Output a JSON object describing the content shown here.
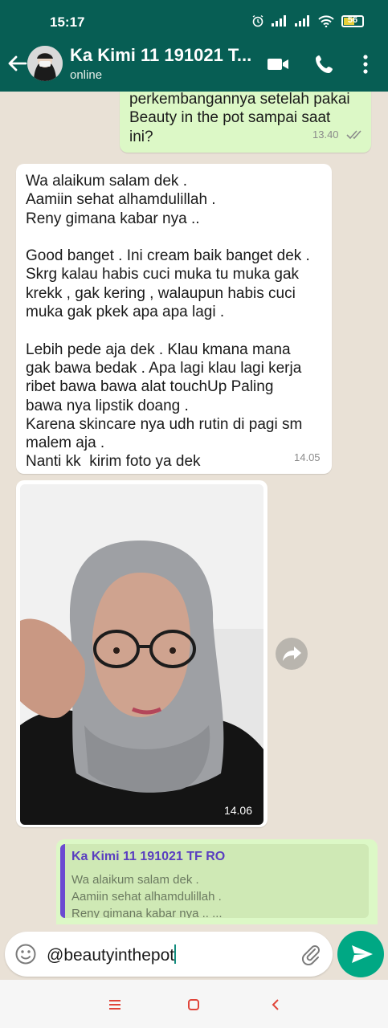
{
  "status": {
    "time": "15:17",
    "battery": "56"
  },
  "header": {
    "title": "Ka Kimi 11 191021 T...",
    "subtitle": "online"
  },
  "messages": [
    {
      "type": "out",
      "text": "perkembangannya setelah pakai\nBeauty in the pot sampai saat\nini?",
      "time": "13.40"
    },
    {
      "type": "in",
      "text": "Wa alaikum salam dek .\nAamiin sehat alhamdulillah .\nReny gimana kabar nya ..\n\nGood banget . Ini cream baik banget dek .\nSkrg kalau habis cuci muka tu muka gak\nkrekk , gak kering , walaupun habis cuci\nmuka gak pkek apa apa lagi .\n\nLebih pede aja dek . Klau kmana mana\ngak bawa bedak . Apa lagi klau lagi kerja\nribet bawa bawa alat touchUp Paling\nbawa nya lipstik doang .\nKarena skincare nya udh rutin di pagi sm\nmalem aja .\nNanti kk  kirim foto ya dek",
      "time": "14.05"
    },
    {
      "type": "in-image",
      "time": "14.06"
    }
  ],
  "reply": {
    "name": "Ka Kimi 11 191021 TF RO",
    "lines": [
      "Wa alaikum salam dek .",
      "Aamiin sehat alhamdulillah .",
      "Reny gimana kabar nya .. ..."
    ]
  },
  "composer": {
    "text": "@beautyinthepot"
  },
  "colors": {
    "header": "#075e54",
    "outgoing": "#dcf8c6",
    "send": "#00a884",
    "nav": "#e0453a"
  }
}
